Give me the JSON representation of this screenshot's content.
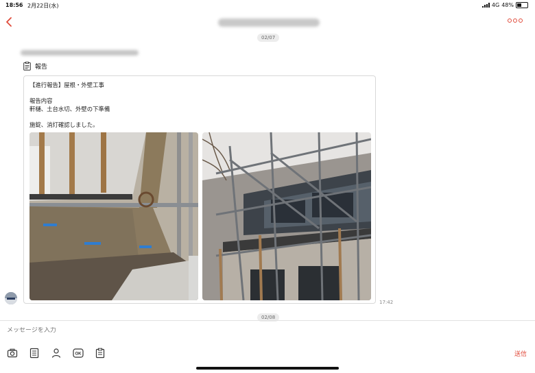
{
  "status_bar": {
    "time": "18:56",
    "date": "2月22日(水)",
    "network": "4G",
    "battery": "48%"
  },
  "nav": {
    "back_icon": "chevron-left-icon",
    "menu_icon": "more-horizontal-icon",
    "accent_color": "#e04a3a"
  },
  "thread": {
    "date_top": "02/07",
    "message": {
      "type_icon": "report-icon",
      "type_label": "報告",
      "body": "【進行報告】屋根・外壁工事\n\n報告内容\n軒樋、土台水切、外壁の下準備\n\n施錠、消灯確認しました。",
      "photos": [
        "construction-site-photo",
        "scaffolding-photo"
      ],
      "time": "17:42"
    },
    "date_next": "02/08"
  },
  "composer": {
    "placeholder": "メッセージを入力",
    "tools": [
      "camera-icon",
      "document-icon",
      "person-icon",
      "ok-icon",
      "report-icon"
    ],
    "send_label": "送信"
  }
}
